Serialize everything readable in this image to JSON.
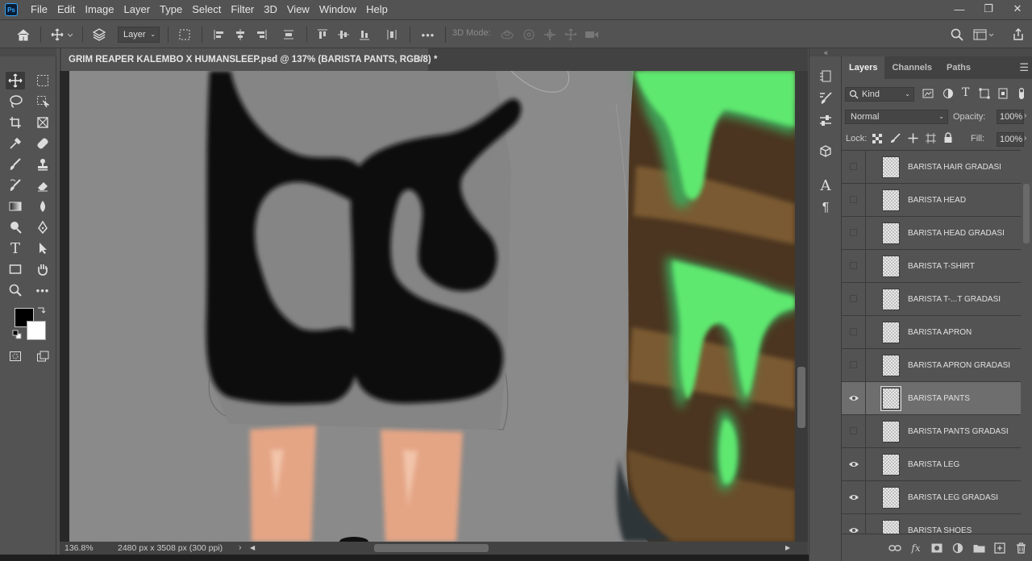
{
  "app": {
    "logo": "Ps"
  },
  "menu": [
    "File",
    "Edit",
    "Image",
    "Layer",
    "Type",
    "Select",
    "Filter",
    "3D",
    "View",
    "Window",
    "Help"
  ],
  "window_controls": {
    "minimize": "—",
    "restore": "❐",
    "close": "✕"
  },
  "options_bar": {
    "auto_select_target": "Layer",
    "three_d_mode_label": "3D Mode:",
    "more_label": "•••"
  },
  "document": {
    "tab_title": "GRIM REAPER KALEMBO X HUMANSLEEP.psd @ 137% (BARISTA PANTS, RGB/8) *",
    "tab_close": "×",
    "zoom": "136.8%",
    "dimensions": "2480 px x 3508 px (300 ppi)",
    "status_arrow": "›"
  },
  "colors": {
    "foreground": "#000000",
    "background": "#ffffff",
    "slime_green": "#5ee870",
    "skin": "#e4a585",
    "barrel_brown": "#7a5a33",
    "canvas_gray": "#8a8a8a"
  },
  "layers_panel": {
    "tabs": [
      "Layers",
      "Channels",
      "Paths"
    ],
    "active_tab": "Layers",
    "filter_kind": "Kind",
    "blend_mode": "Normal",
    "opacity_label": "Opacity:",
    "opacity": "100%",
    "lock_label": "Lock:",
    "fill_label": "Fill:",
    "fill": "100%",
    "layers": [
      {
        "name": "BARISTA HAIR GRADASI",
        "visible": false,
        "selected": false
      },
      {
        "name": "BARISTA HEAD",
        "visible": false,
        "selected": false
      },
      {
        "name": "BARISTA HEAD GRADASI",
        "visible": false,
        "selected": false
      },
      {
        "name": "BARISTA T-SHIRT",
        "visible": false,
        "selected": false
      },
      {
        "name": "BARISTA T-...T GRADASI",
        "visible": false,
        "selected": false
      },
      {
        "name": "BARISTA APRON",
        "visible": false,
        "selected": false
      },
      {
        "name": "BARISTA APRON GRADASI",
        "visible": false,
        "selected": false
      },
      {
        "name": "BARISTA PANTS",
        "visible": true,
        "selected": true
      },
      {
        "name": "BARISTA PANTS GRADASI",
        "visible": false,
        "selected": false
      },
      {
        "name": "BARISTA LEG",
        "visible": true,
        "selected": false
      },
      {
        "name": "BARISTA LEG GRADASI",
        "visible": true,
        "selected": false
      },
      {
        "name": "BARISTA SHOES",
        "visible": true,
        "selected": false
      }
    ]
  },
  "icons": {
    "home": "home-icon",
    "move": "move-icon",
    "eye": "eye-icon"
  }
}
